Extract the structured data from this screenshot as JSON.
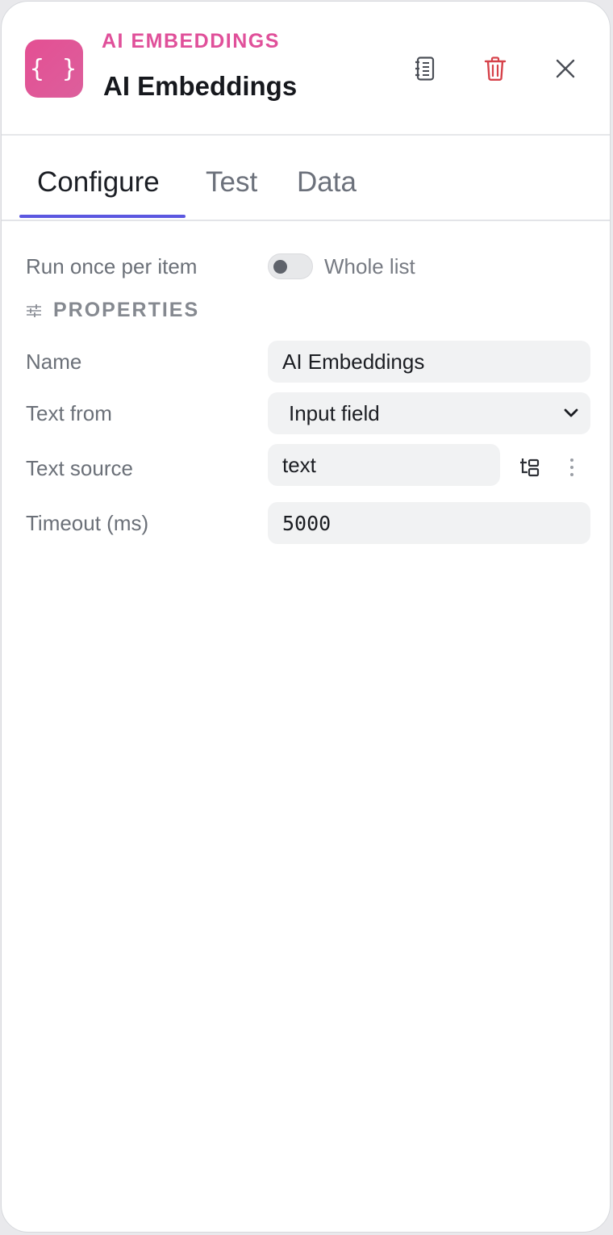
{
  "header": {
    "node_type": "AI EMBEDDINGS",
    "title": "AI Embeddings",
    "icon_glyph": "{ }",
    "icon": "curly-braces-icon",
    "actions": [
      "notebook-icon",
      "trash-icon",
      "close-icon"
    ],
    "accent_color": "#e0509a",
    "danger_color": "#d6424a"
  },
  "tabs": [
    {
      "label": "Configure",
      "active": true
    },
    {
      "label": "Test",
      "active": false
    },
    {
      "label": "Data",
      "active": false
    }
  ],
  "tab_accent_color": "#5b57e0",
  "run_mode": {
    "label": "Run once per item",
    "toggle_label": "Whole list",
    "enabled": false
  },
  "properties": {
    "section_title": "PROPERTIES",
    "section_icon": "sliders-icon",
    "fields": {
      "name": {
        "label": "Name",
        "value": "AI Embeddings"
      },
      "text_from": {
        "label": "Text from",
        "value": "Input field"
      },
      "text_source": {
        "label": "Text source",
        "value": "text"
      },
      "timeout": {
        "label": "Timeout (ms)",
        "value": "5000"
      }
    }
  }
}
